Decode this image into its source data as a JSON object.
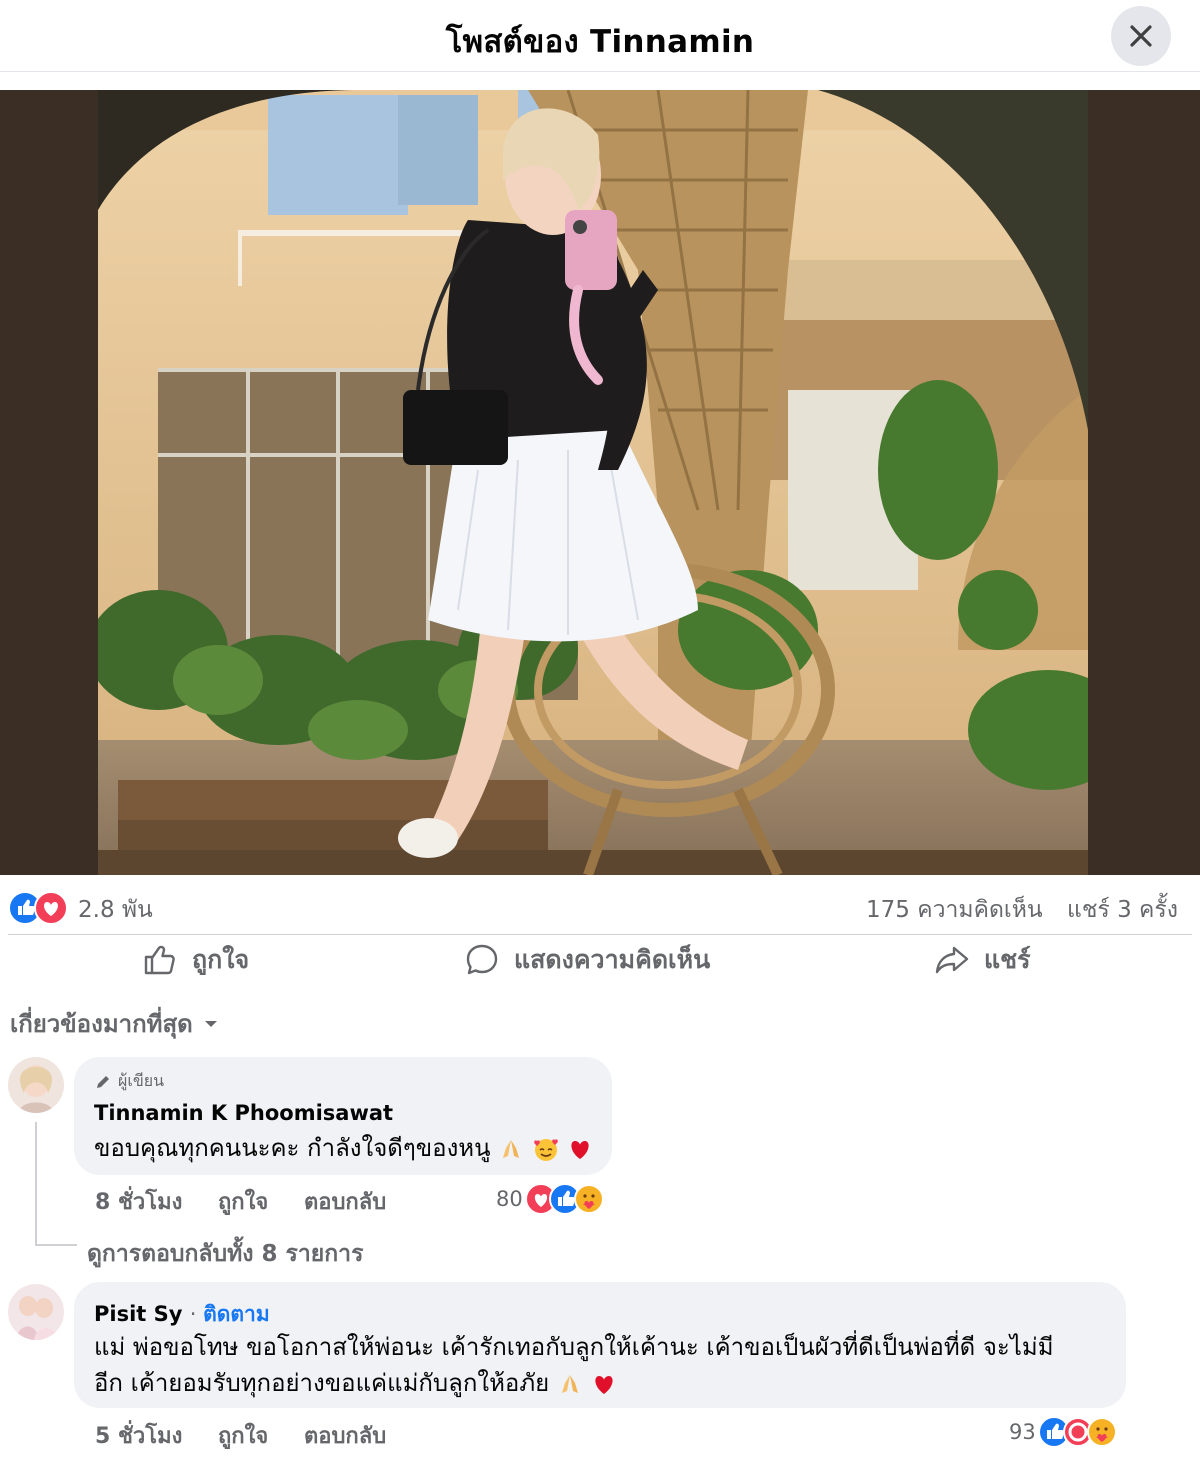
{
  "header": {
    "title": "โพสต์ของ Tinnamin",
    "close_icon": "close-icon"
  },
  "post": {
    "photo_icon": "post-photo"
  },
  "stats": {
    "reactions": [
      "like",
      "love"
    ],
    "reaction_count": "2.8 พัน",
    "comments": "175 ความคิดเห็น",
    "shares": "แชร์ 3 ครั้ง"
  },
  "actions": {
    "like_label": "ถูกใจ",
    "comment_label": "แสดงความคิดเห็น",
    "share_label": "แชร์"
  },
  "sort": {
    "label": "เกี่ยวข้องมากที่สุด"
  },
  "comments": [
    {
      "author_badge": "ผู้เขียน",
      "name": "Tinnamin K Phoomisawat",
      "text": "ขอบคุณทุกคนนะคะ กำลังใจดีๆของหนู",
      "emojis": [
        "folded-hands",
        "smiling-face-with-hearts",
        "red-heart"
      ],
      "time": "8 ชั่วโมง",
      "like_label": "ถูกใจ",
      "reply_label": "ตอบกลับ",
      "reaction_count": "80",
      "reactions": [
        "love",
        "like",
        "care"
      ],
      "view_replies": "ดูการตอบกลับทั้ง 8 รายการ"
    },
    {
      "name": "Pisit Sy",
      "follow_label": "ติดตาม",
      "text_line1": "แม่ พ่อขอโทษ ขอโอกาสให้พ่อนะ เค้ารักเทอกับลูกให้เค้านะ เค้าขอเป็นผัวที่ดีเป็นพ่อที่ดี จะไม่มี",
      "text_line2": "อีก เค้ายอมรับทุกอย่างขอแค่แม่กับลูกให้อภัย",
      "emojis": [
        "folded-hands",
        "red-heart"
      ],
      "time": "5 ชั่วโมง",
      "like_label": "ถูกใจ",
      "reply_label": "ตอบกลับ",
      "reaction_count": "93",
      "reactions": [
        "like",
        "sad",
        "care"
      ]
    }
  ],
  "colors": {
    "like_blue": "#1877f2",
    "love_red": "#f33e58",
    "secondary_text": "#65676b",
    "bubble_bg": "#f0f2f5"
  }
}
